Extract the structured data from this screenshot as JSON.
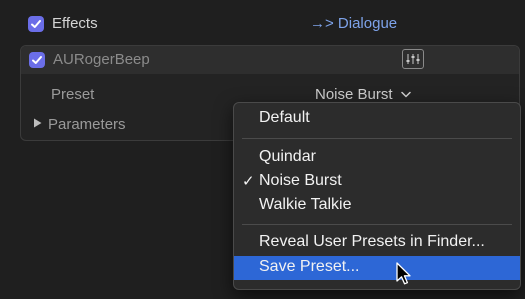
{
  "effects": {
    "label": "Effects",
    "checked": true,
    "route": "→> Dialogue"
  },
  "plugin": {
    "name": "AURogerBeep",
    "checked": true,
    "edit_icon": "plugin-edit-icon",
    "preset_label": "Preset",
    "preset_value": "Noise Burst",
    "parameters_label": "Parameters"
  },
  "menu": {
    "items": [
      {
        "label": "Default",
        "checked": false
      },
      {
        "label": "Quindar",
        "checked": false
      },
      {
        "label": "Noise Burst",
        "checked": true
      },
      {
        "label": "Walkie Talkie",
        "checked": false
      },
      {
        "label": "Reveal User Presets in Finder...",
        "checked": false
      },
      {
        "label": "Save Preset...",
        "checked": false,
        "highlighted": true
      }
    ],
    "check_glyph": "✓",
    "highlight_color": "#2d67d6"
  },
  "colors": {
    "accent": "#6b6ee8",
    "link": "#7ea3ea",
    "background": "#1f1f1f"
  }
}
